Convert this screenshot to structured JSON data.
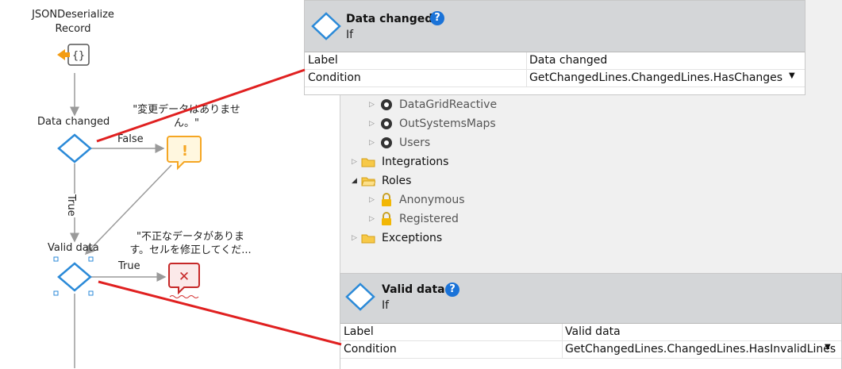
{
  "flow": {
    "nodes": {
      "deserialize_label": "JSONDeserialize\nRecord",
      "data_changed_label": "Data changed",
      "valid_data_label": "Valid data"
    },
    "edges": {
      "false_label": "False",
      "true_label_down": "True",
      "true_label_right": "True"
    },
    "messages": {
      "no_changes": "\"変更データはありませ\nん。\"",
      "invalid": "\"不正なデータがありま\nす。セルを修正してくだ..."
    }
  },
  "panel_top": {
    "title": "Data changed",
    "subtitle": "If",
    "props": [
      {
        "key": "Label",
        "value": "Data changed"
      },
      {
        "key": "Condition",
        "value": "GetChangedLines.ChangedLines.HasChanges"
      }
    ]
  },
  "tree": {
    "items": [
      {
        "label": "DataGridReactive",
        "type": "module"
      },
      {
        "label": "OutSystemsMaps",
        "type": "module"
      },
      {
        "label": "Users",
        "type": "module"
      },
      {
        "label": "Integrations",
        "type": "folder"
      },
      {
        "label": "Roles",
        "type": "folder-open"
      },
      {
        "label": "Anonymous",
        "type": "lock"
      },
      {
        "label": "Registered",
        "type": "lock"
      },
      {
        "label": "Exceptions",
        "type": "folder"
      }
    ]
  },
  "panel_bottom": {
    "title": "Valid data",
    "subtitle": "If",
    "props": [
      {
        "key": "Label",
        "value": "Valid data"
      },
      {
        "key": "Condition",
        "value": "GetChangedLines.ChangedLines.HasInvalidLines"
      }
    ]
  },
  "colors": {
    "annotation_red": "#e02020",
    "diamond_blue": "#2b8ad8",
    "alert_orange": "#f5a623",
    "error_red": "#c62828"
  }
}
